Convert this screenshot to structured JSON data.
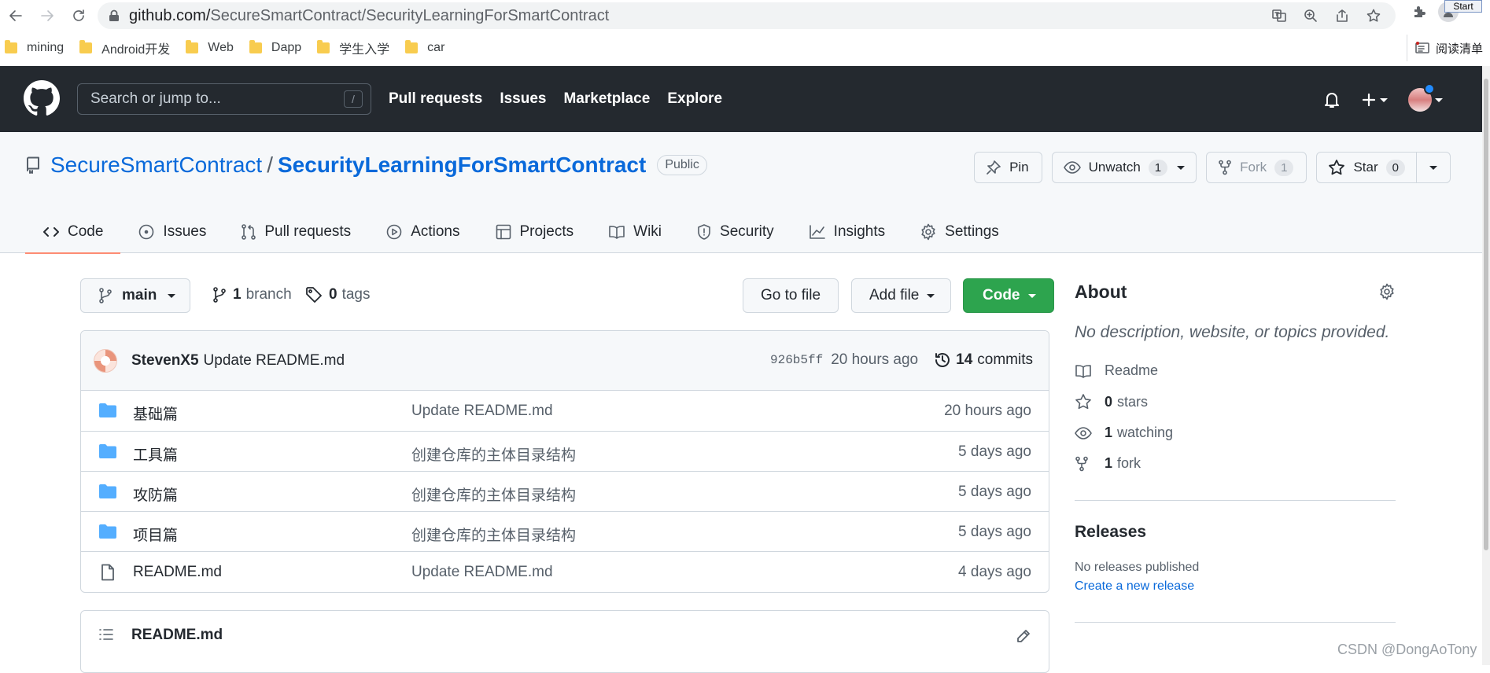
{
  "browser": {
    "url_host": "github.com/",
    "url_path": "SecureSmartContract/SecurityLearningForSmartContract",
    "tooltip": "Start",
    "bookmarks": [
      "mining",
      "Android开发",
      "Web",
      "Dapp",
      "学生入学",
      "car"
    ],
    "reading_list": "阅读清单"
  },
  "header": {
    "search_placeholder": "Search or jump to...",
    "search_key": "/",
    "nav": [
      "Pull requests",
      "Issues",
      "Marketplace",
      "Explore"
    ]
  },
  "repo": {
    "owner": "SecureSmartContract",
    "separator": "/",
    "name": "SecurityLearningForSmartContract",
    "visibility": "Public",
    "actions": {
      "pin": "Pin",
      "unwatch": "Unwatch",
      "watch_count": "1",
      "fork": "Fork",
      "fork_count": "1",
      "star": "Star",
      "star_count": "0"
    },
    "tabs": [
      "Code",
      "Issues",
      "Pull requests",
      "Actions",
      "Projects",
      "Wiki",
      "Security",
      "Insights",
      "Settings"
    ]
  },
  "toolbar": {
    "branch": "main",
    "branch_count": "1",
    "branch_label": "branch",
    "tag_count": "0",
    "tag_label": "tags",
    "goto_file": "Go to file",
    "add_file": "Add file",
    "code": "Code"
  },
  "commit": {
    "author": "StevenX5",
    "message": "Update README.md",
    "sha": "926b5ff",
    "time": "20 hours ago",
    "count": "14",
    "count_label": "commits"
  },
  "files": [
    {
      "type": "folder",
      "name": "基础篇",
      "message": "Update README.md",
      "age": "20 hours ago"
    },
    {
      "type": "folder",
      "name": "工具篇",
      "message": "创建仓库的主体目录结构",
      "age": "5 days ago"
    },
    {
      "type": "folder",
      "name": "攻防篇",
      "message": "创建仓库的主体目录结构",
      "age": "5 days ago"
    },
    {
      "type": "folder",
      "name": "项目篇",
      "message": "创建仓库的主体目录结构",
      "age": "5 days ago"
    },
    {
      "type": "file",
      "name": "README.md",
      "message": "Update README.md",
      "age": "4 days ago"
    }
  ],
  "readme": {
    "title": "README.md"
  },
  "about": {
    "heading": "About",
    "description": "No description, website, or topics provided.",
    "readme": "Readme",
    "stars_count": "0",
    "stars_label": "stars",
    "watching_count": "1",
    "watching_label": "watching",
    "fork_count": "1",
    "fork_label": "fork"
  },
  "releases": {
    "heading": "Releases",
    "none": "No releases published",
    "create": "Create a new release"
  },
  "watermark": "CSDN @DongAoTony",
  "colors": {
    "header_bg": "#24292f",
    "link": "#0969da",
    "code_button": "#2da44e",
    "tab_underline": "#fd8c73",
    "folder": "#54aeff"
  }
}
